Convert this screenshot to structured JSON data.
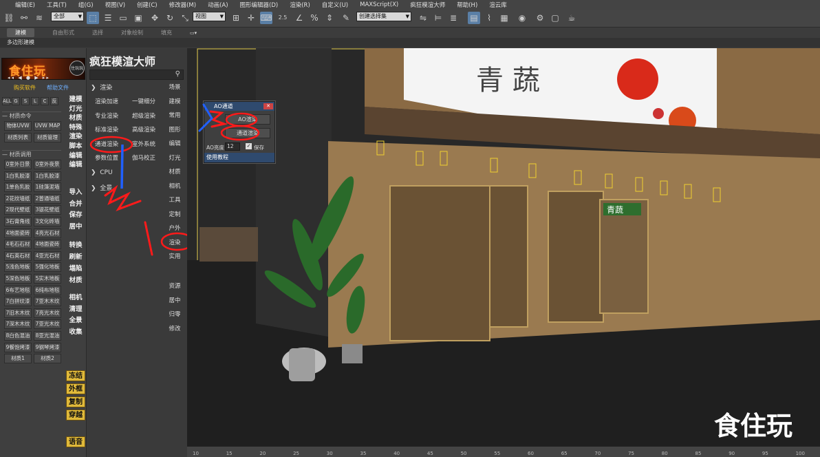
{
  "menu": [
    "编辑(E)",
    "工具(T)",
    "组(G)",
    "视图(V)",
    "创建(C)",
    "修改器(M)",
    "动画(A)",
    "图形编辑器(D)",
    "渲染(R)",
    "自定义(U)",
    "MAXScript(X)",
    "疯狂模渲大师",
    "帮助(H)",
    "渲云库"
  ],
  "toolbar": {
    "filter_value": "全部",
    "view_value": "视图",
    "selection_set_value": "创建选择集",
    "snap_value": "2.5"
  },
  "ribbon": {
    "tabs": [
      "建模",
      "自由形式",
      "选择",
      "对象绘制",
      "填充"
    ],
    "subtab": "多边形建模"
  },
  "left": {
    "banner_logo": "食住玩",
    "banner_badge": "住玩玩",
    "banner_nav": "◂◂ ◀ ● ▶ ▸▸",
    "buy_link": "购买软件",
    "help_link": "帮助文件",
    "material_cmd": "材质命令",
    "small_buttons": [
      "ALL",
      "G",
      "S",
      "L",
      "C",
      "反"
    ],
    "mat_cmd_buttons": [
      "物体UVW",
      "UVW MAP",
      "材质列表",
      "材质管理"
    ],
    "material_lib": "材质调用",
    "materials": [
      "0室外日景",
      "0室外夜景",
      "1白乳胶漆",
      "1白乳胶漆",
      "1单色乳胶",
      "1硅藻泥墙",
      "2花纹墙纸",
      "2普通墙纸",
      "2现代壁纸",
      "3银花壁纸",
      "3石膏角线",
      "3文化砖墙",
      "4地面瓷砖",
      "4亮光石材",
      "4毛石石材",
      "4地面瓷砖",
      "4石英石材",
      "4亚光石材",
      "5浅色地板",
      "5强化地板",
      "5深色地板",
      "5实木地板",
      "6布艺地毯",
      "6纯布地毯",
      "7白拼纹漆",
      "7亚木木纹",
      "7旧木木纹",
      "7亮光木纹",
      "7深木木纹",
      "7亚光木纹",
      "8白色混油",
      "8亚光混油",
      "9餐饱烤漆",
      "9钢琴烤漆"
    ],
    "mat_tabs": [
      "材质1",
      "材质2"
    ],
    "side_cmds_a": [
      "建模",
      "灯光",
      "材质",
      "特殊",
      "渲染",
      "脚本",
      "编辑",
      "编辑"
    ],
    "side_cmds_b": [
      "导入",
      "合并",
      "保存",
      "居中"
    ],
    "side_cmds_c": [
      "转换",
      "刷新",
      "塌陷",
      "材质"
    ],
    "side_cmds_d": [
      "相机",
      "清理",
      "全景",
      "收集"
    ],
    "yellow_buttons": [
      "冻结",
      "外框",
      "复制",
      "穿越"
    ],
    "voice": "语音"
  },
  "plugin": {
    "title": "疯狂模渲大师",
    "section_render": "渲染",
    "buttons": [
      "渲染加速",
      "一键细分",
      "专业渲染",
      "超级渲染",
      "标准渲染",
      "高级渲染",
      "通道渲染",
      "室外系统",
      "参数位置",
      "伽马校正"
    ],
    "section_cpu": "CPU",
    "section_pano": "全景",
    "right_col": [
      "场景",
      "建模",
      "常用",
      "图形",
      "编辑",
      "灯光",
      "材质",
      "相机",
      "工具",
      "定制",
      "户外",
      "渲染",
      "实用"
    ],
    "right_col_b": [
      "资源",
      "居中",
      "归零",
      "修改"
    ]
  },
  "ao_dialog": {
    "title": "AO通道",
    "ao_button": "AO渲染",
    "channel_button": "通道渲染",
    "brightness_label": "AO亮度",
    "brightness_value": "12",
    "save_label": "保存",
    "tutorial": "使用教程"
  },
  "viewport": {
    "sign_text": "青 蔬",
    "shop_sign": "青蔬",
    "watermark": "食住玩"
  },
  "ruler": {
    "ticks": [
      "10",
      "15",
      "20",
      "25",
      "30",
      "35",
      "40",
      "45",
      "50",
      "55",
      "60",
      "65",
      "70",
      "75",
      "80",
      "85",
      "90",
      "95",
      "100"
    ]
  },
  "colors": {
    "accent": "#e0b93a",
    "annotation_red": "#ff1a1a",
    "annotation_blue": "#2060ff",
    "link_yellow": "#f0c020",
    "viewport_border": "#c8b44a"
  }
}
